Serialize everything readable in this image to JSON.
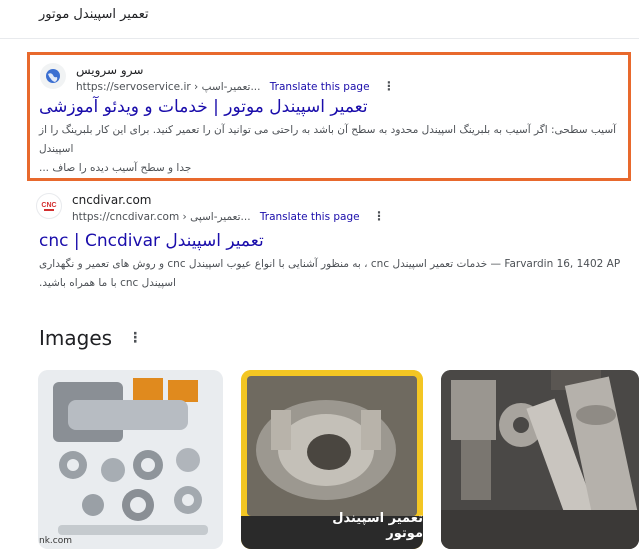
{
  "search": {
    "query": "تعمیر اسپیندل موتور"
  },
  "results": [
    {
      "site_name": "سرو سرویس",
      "url": "https://servoservice.ir › تعمیر-اسپ...",
      "translate": "Translate this page",
      "title": "تعمیر اسپیندل موتور | خدمات و ویدئو آموزشی",
      "snippet_line1": "آسیب سطحی: اگر آسیب به بلبرینگ اسپیندل محدود به سطح آن باشد به راحتی می توانید آن را تعمیر کنید. برای این کار بلبرینگ را از اسپیندل",
      "snippet_line2": "جدا و سطح آسیب دیده را صاف ...",
      "icon": "globe-icon"
    },
    {
      "site_name": "cncdivar.com",
      "url": "https://cncdivar.com › تعمیر-اسپی...",
      "translate": "Translate this page",
      "title": "cnc | Cncdivar تعمیر اسپیندل",
      "snippet_line1": "Farvardin 16, 1402 AP — خدمات تعمیر اسپیندل cnc ، به منظور آشنایی با انواع عیوب اسپیندل cnc و روش های تعمیر و نگهداری",
      "snippet_line2": "اسپیندل cnc با ما همراه باشید.",
      "logo_text": "CNC",
      "icon": "cnc-logo-icon"
    }
  ],
  "images": {
    "heading": "Images",
    "thumbs": [
      {
        "alt": "spindle-parts",
        "source_fragment": "nk.com"
      },
      {
        "alt": "spindle-motor",
        "caption": "تعمیر اسپیندل موتور"
      },
      {
        "alt": "spindle-machine"
      }
    ]
  },
  "colors": {
    "link": "#1a0dab",
    "highlight_border": "#e8692d",
    "text": "#202124",
    "secondary": "#4d5156"
  }
}
